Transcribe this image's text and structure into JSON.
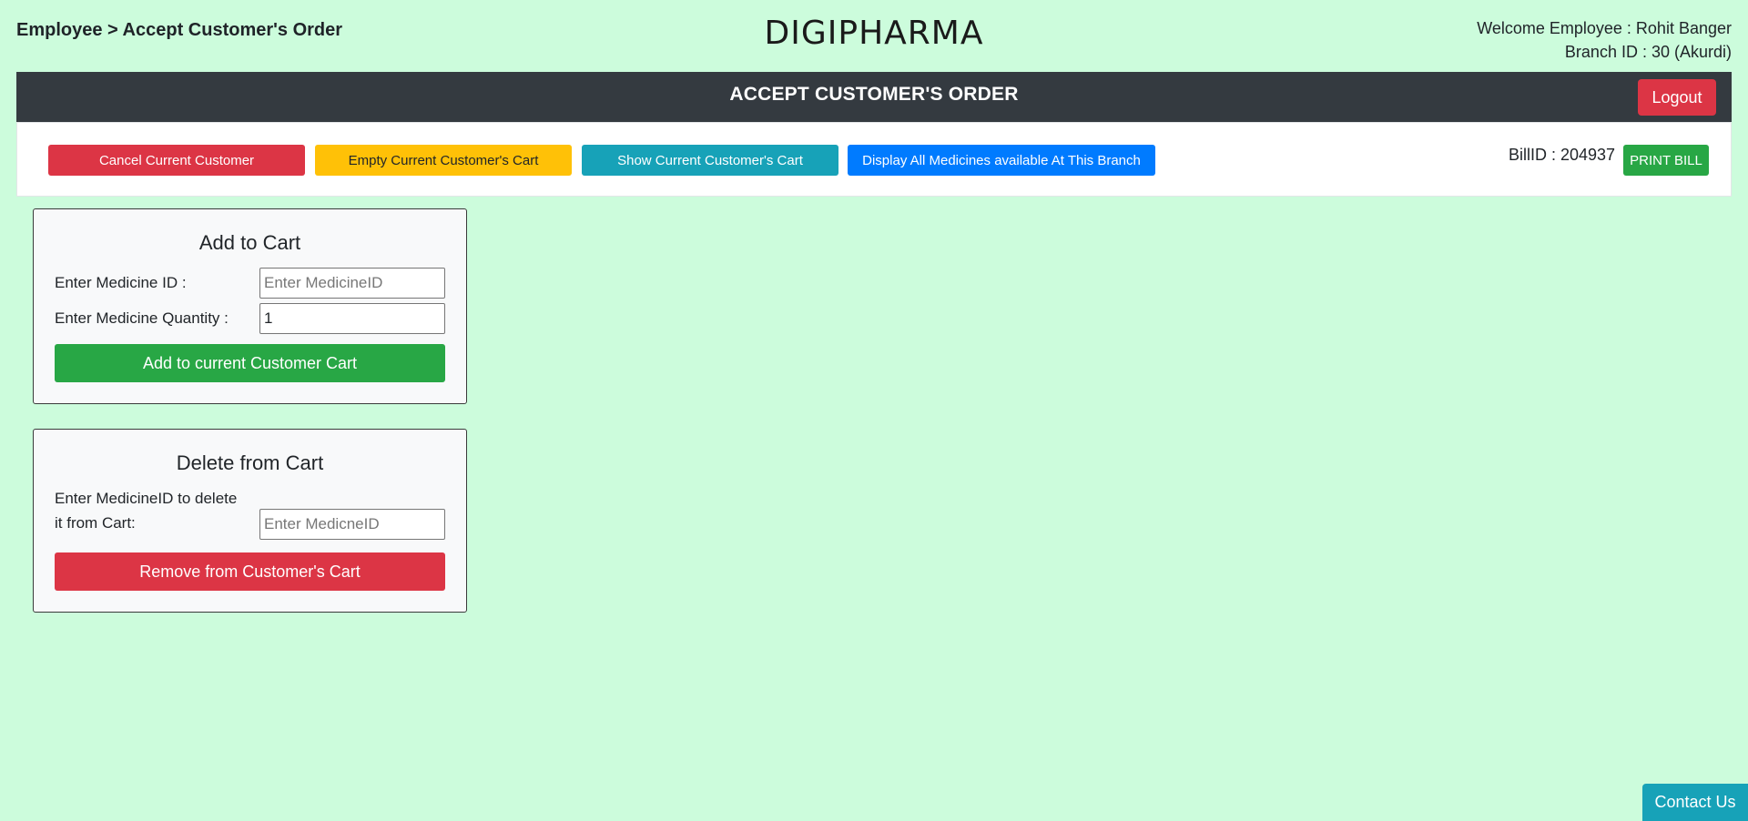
{
  "page": {
    "breadcrumb": "Employee > Accept Customer's Order",
    "brand": "DIGIPHARMA",
    "welcome": "Welcome Employee : Rohit Banger",
    "branch": "Branch ID : 30 (Akurdi)"
  },
  "header": {
    "title": "ACCEPT CUSTOMER'S ORDER",
    "logout_label": "Logout"
  },
  "actions": {
    "cancel_label": "Cancel Current Customer",
    "empty_label": "Empty Current Customer's Cart",
    "show_label": "Show Current Customer's Cart",
    "display_label": "Display All Medicines available At This Branch",
    "bill_id": "BillID : 204937",
    "print_label": "PRINT BILL"
  },
  "add_card": {
    "title": "Add to Cart",
    "medicine_id_label": "Enter Medicine ID :",
    "medicine_id_placeholder": "Enter MedicineID",
    "medicine_id_value": "",
    "quantity_label": "Enter Medicine Quantity :",
    "quantity_value": "1",
    "submit_label": "Add to current Customer Cart"
  },
  "delete_card": {
    "title": "Delete from Cart",
    "label_line1": "Enter MedicineID to delete",
    "label_line2": "it from Cart:",
    "placeholder": "Enter MedicneID",
    "value": "",
    "submit_label": "Remove from Customer's Cart"
  },
  "footer": {
    "contact_label": "Contact Us"
  },
  "colors": {
    "page_bg": "#ccfcdc",
    "header_bg": "#343a40",
    "danger": "#dc3545",
    "warning": "#ffc107",
    "info": "#17a2b8",
    "primary": "#007bff",
    "success": "#28a745"
  }
}
